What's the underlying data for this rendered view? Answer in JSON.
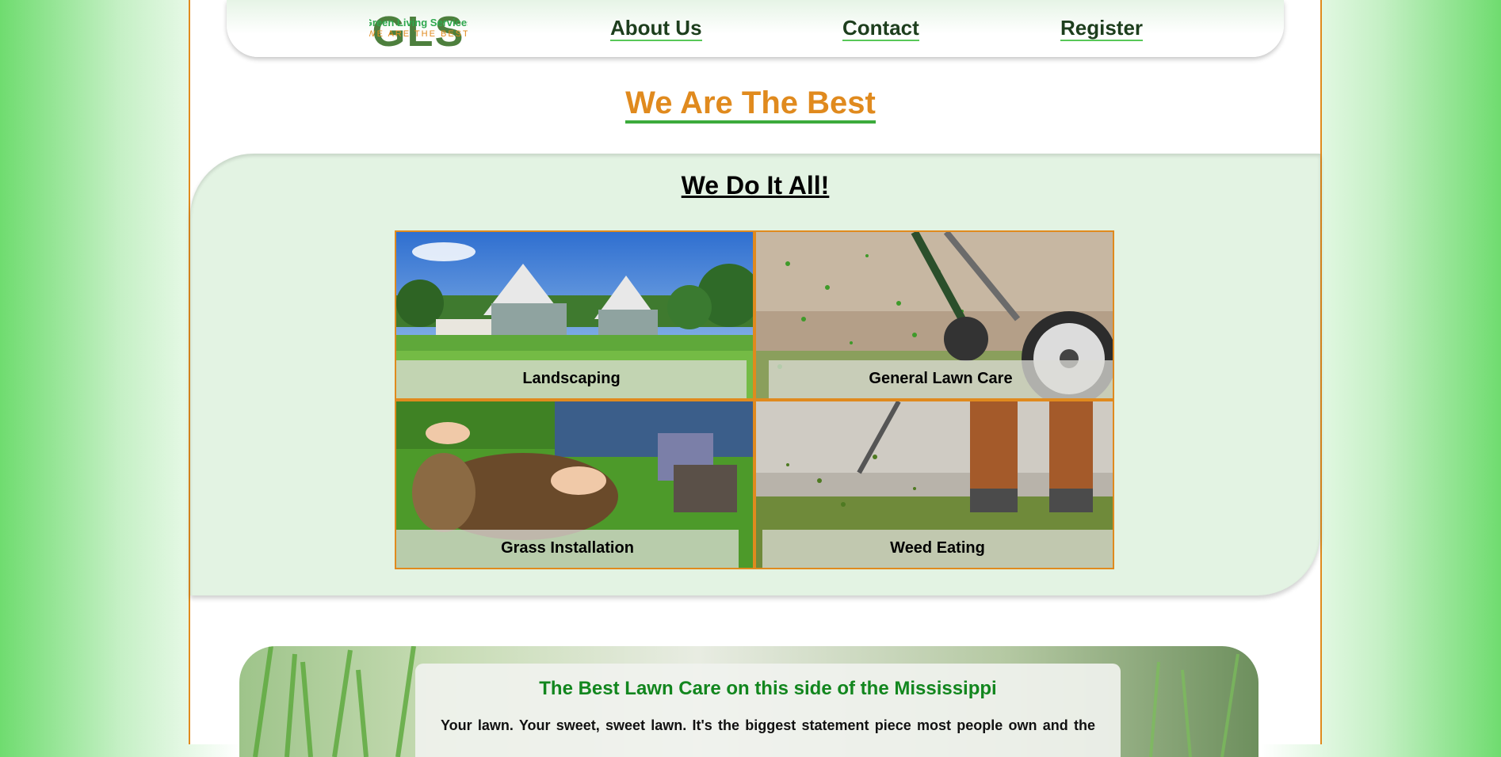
{
  "nav": {
    "logo_text": "GLS",
    "logo_tagline_top": "Green Living Services",
    "logo_tagline_bottom": "WE ARE THE BEST",
    "links": [
      "About Us",
      "Contact",
      "Register"
    ]
  },
  "headline": "We Are The Best",
  "services": {
    "title": "We Do It All!",
    "items": [
      "Landscaping",
      "General Lawn Care",
      "Grass Installation",
      "Weed Eating"
    ]
  },
  "promo": {
    "title": "The Best Lawn Care on this side of the Mississippi",
    "body": "Your lawn. Your sweet, sweet lawn. It's the biggest statement piece most people own and the"
  },
  "colors": {
    "accent_orange": "#e08a1e",
    "brand_green": "#12861e",
    "services_bg": "#e3f3e3"
  }
}
